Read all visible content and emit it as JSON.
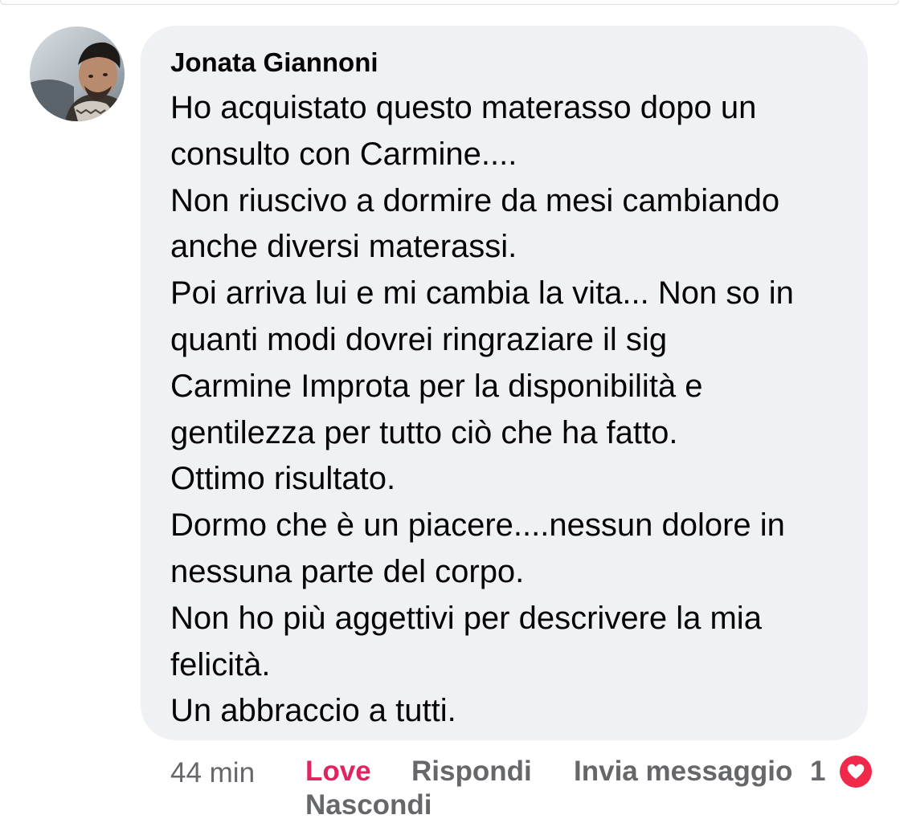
{
  "comment": {
    "author": "Jonata Giannoni",
    "lines": [
      "Ho acquistato questo materasso dopo un",
      "consulto con Carmine....",
      "Non riuscivo a dormire da mesi cambiando",
      "anche diversi materassi.",
      "Poi arriva lui e mi cambia la vita... Non so in",
      "quanti modi dovrei ringraziare il sig",
      "Carmine Improta per la disponibilità e",
      "gentilezza per tutto ciò che ha fatto.",
      "Ottimo risultato.",
      "Dormo che è un piacere....nessun dolore in",
      "nessuna parte del corpo.",
      "Non ho più aggettivi per descrivere la mia",
      "felicità.",
      "Un abbraccio a tutti."
    ]
  },
  "actions": {
    "time": "44 min",
    "love_label": "Love",
    "reply_label": "Rispondi",
    "send_message_label": "Invia messaggio",
    "reaction_count": "1",
    "reaction_icon": "heart-icon",
    "hide_label": "Nascondi"
  },
  "colors": {
    "bubble_bg": "#f0f1f5",
    "love": "#e0245e",
    "secondary_text": "#65676b",
    "text": "#050505"
  }
}
